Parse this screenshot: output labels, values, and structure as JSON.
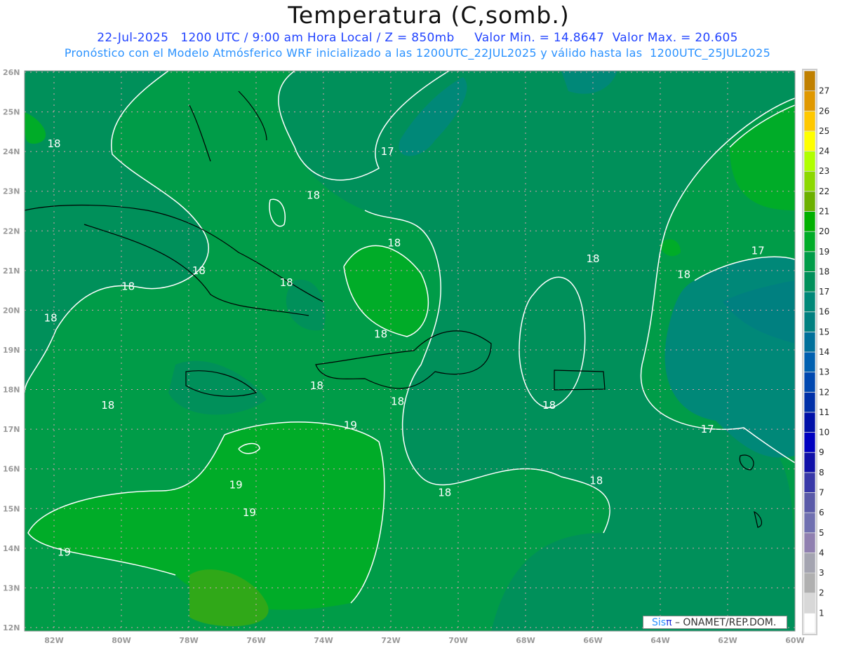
{
  "title": "Temperatura (C,somb.)",
  "subtitle1": "22-Jul-2025   1200 UTC / 9:00 am Hora Local / Z = 850mb     Valor Min. = 14.8647  Valor Max. = 20.605",
  "subtitle2": "Pronóstico con el Modelo Atmósferico WRF inicializado a las 1200UTC_22JUL2025 y válido hasta las  1200UTC_25JUL2025",
  "credit": {
    "brand_a": "Sis",
    "brand_b": "π",
    "text": " – ONAMET/REP.DOM."
  },
  "map": {
    "lat_labels": [
      "26N",
      "25N",
      "24N",
      "23N",
      "22N",
      "21N",
      "20N",
      "19N",
      "18N",
      "17N",
      "16N",
      "15N",
      "14N",
      "13N",
      "12N"
    ],
    "lon_labels": [
      "82W",
      "80W",
      "78W",
      "76W",
      "74W",
      "72W",
      "70W",
      "68W",
      "66W",
      "64W",
      "62W",
      "60W"
    ],
    "contour_labels": [
      {
        "t": "18",
        "lon": -82.0,
        "lat": 24.2
      },
      {
        "t": "17",
        "lon": -72.1,
        "lat": 24.0
      },
      {
        "t": "18",
        "lon": -74.3,
        "lat": 22.9
      },
      {
        "t": "18",
        "lon": -71.9,
        "lat": 21.7
      },
      {
        "t": "18",
        "lon": -66.0,
        "lat": 21.3
      },
      {
        "t": "17",
        "lon": -61.1,
        "lat": 21.5
      },
      {
        "t": "18",
        "lon": -63.3,
        "lat": 20.9
      },
      {
        "t": "18",
        "lon": -77.7,
        "lat": 21.0
      },
      {
        "t": "18",
        "lon": -75.1,
        "lat": 20.7
      },
      {
        "t": "18",
        "lon": -79.8,
        "lat": 20.6
      },
      {
        "t": "18",
        "lon": -82.1,
        "lat": 19.8
      },
      {
        "t": "18",
        "lon": -72.3,
        "lat": 19.4
      },
      {
        "t": "18",
        "lon": -74.2,
        "lat": 18.1
      },
      {
        "t": "18",
        "lon": -80.4,
        "lat": 17.6
      },
      {
        "t": "18",
        "lon": -71.8,
        "lat": 17.7
      },
      {
        "t": "18",
        "lon": -67.3,
        "lat": 17.6
      },
      {
        "t": "17",
        "lon": -62.6,
        "lat": 17.0
      },
      {
        "t": "19",
        "lon": -73.2,
        "lat": 17.1
      },
      {
        "t": "19",
        "lon": -76.6,
        "lat": 15.6
      },
      {
        "t": "19",
        "lon": -76.2,
        "lat": 14.9
      },
      {
        "t": "18",
        "lon": -70.4,
        "lat": 15.4
      },
      {
        "t": "18",
        "lon": -65.9,
        "lat": 15.7
      },
      {
        "t": "19",
        "lon": -81.7,
        "lat": 13.9
      }
    ]
  },
  "colorbar": {
    "labels": [
      "1",
      "2",
      "3",
      "4",
      "5",
      "6",
      "7",
      "8",
      "9",
      "10",
      "11",
      "12",
      "13",
      "14",
      "15",
      "16",
      "17",
      "18",
      "19",
      "20",
      "21",
      "22",
      "23",
      "24",
      "25",
      "26",
      "27"
    ],
    "colors": [
      "#ffffff",
      "#d8d8d8",
      "#b0b0b0",
      "#a4a4b0",
      "#9080b0",
      "#7070b0",
      "#5a5aa8",
      "#3838a8",
      "#1010a8",
      "#0000c0",
      "#0010a8",
      "#0030a8",
      "#0048b0",
      "#0060b0",
      "#00709a",
      "#008080",
      "#008878",
      "#00905a",
      "#009c48",
      "#00ac28",
      "#00b000",
      "#6cb000",
      "#8cd800",
      "#b0ff00",
      "#ffff00",
      "#ffc800",
      "#e09800",
      "#c08000"
    ]
  }
}
